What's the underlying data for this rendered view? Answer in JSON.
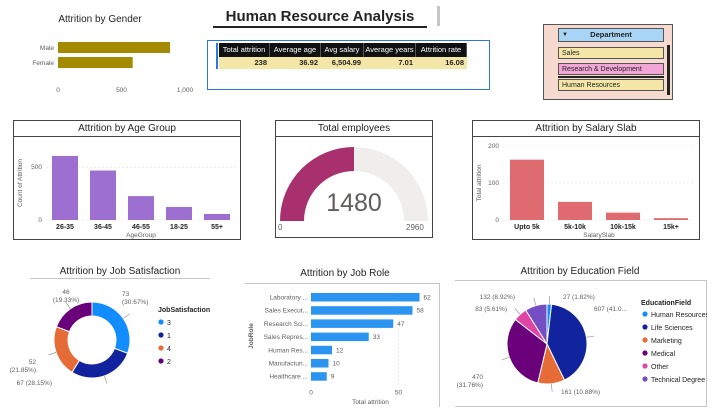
{
  "header": {
    "title": "Human Resource Analysis"
  },
  "kpi": {
    "headers": [
      "Total attrition",
      "Average age",
      "Avg salary",
      "Average years",
      "Attrition rate"
    ],
    "values": [
      "238",
      "36.92",
      "6,504.99",
      "7.01",
      "16.08"
    ]
  },
  "department": {
    "title": "Department",
    "items": [
      "Sales",
      "Research & Development",
      "Human Resources"
    ],
    "colors": [
      "#f4e6a6",
      "#f2a6d6",
      "#f4e6a6"
    ]
  },
  "gauge": {
    "title": "Total employees",
    "value_label": "1480",
    "min_label": "0",
    "max_label": "2960",
    "value": 1480,
    "max": 2960,
    "fill_color": "#a8306f",
    "track_color": "#efeeed"
  },
  "chart_data": [
    {
      "type": "bar",
      "orientation": "horizontal",
      "title": "Attrition by Gender",
      "categories": [
        "Male",
        "Female"
      ],
      "values": [
        882,
        588
      ],
      "xticks": [
        "0",
        "500",
        "1,000"
      ],
      "xlim": [
        0,
        1000
      ],
      "color": "#a38a00"
    },
    {
      "type": "bar",
      "title": "Attrition by Age Group",
      "categories": [
        "26-35",
        "36-45",
        "46-55",
        "18-25",
        "55+"
      ],
      "values": [
        606,
        468,
        226,
        123,
        57
      ],
      "xlabel": "AgeGroup",
      "ylabel": "Count of Attrition",
      "yticks": [
        "0",
        "500"
      ],
      "ylim": [
        0,
        700
      ],
      "color": "#9c6fd1"
    },
    {
      "type": "bar",
      "title": "Attrition by Salary Slab",
      "categories": [
        "Upto 5k",
        "5k-10k",
        "10k-15k",
        "15k+"
      ],
      "values": [
        163,
        49,
        20,
        5
      ],
      "xlabel": "SalarySlab",
      "ylabel": "Total attrition",
      "yticks": [
        "0",
        "100",
        "200"
      ],
      "ylim": [
        0,
        200
      ],
      "color": "#df6b71"
    },
    {
      "type": "pie",
      "variant": "donut",
      "title": "Attrition by Job Satisfaction",
      "legend_title": "JobSatisfaction",
      "series": [
        {
          "name": "3",
          "value": 73,
          "label": "73\n(30.67%)",
          "color": "#118dff"
        },
        {
          "name": "1",
          "value": 67,
          "label": "67 (28.15%)",
          "color": "#12239e"
        },
        {
          "name": "4",
          "value": 52,
          "label": "52\n(21.85%)",
          "color": "#e66c37"
        },
        {
          "name": "2",
          "value": 46,
          "label": "46\n(19.33%)",
          "color": "#6b007b"
        }
      ]
    },
    {
      "type": "bar",
      "orientation": "horizontal",
      "title": "Attrition by Job Role",
      "categories": [
        "Laboratory ...",
        "Sales Execut...",
        "Research Sci...",
        "Sales Repres...",
        "Human Res...",
        "Manufacturi...",
        "Healthcare ..."
      ],
      "values": [
        62,
        58,
        47,
        33,
        12,
        10,
        9
      ],
      "xlabel": "Total attrition",
      "ylabel": "JobRole",
      "xticks": [
        "0",
        "50"
      ],
      "xlim": [
        0,
        68
      ],
      "color": "#2b94f0"
    },
    {
      "type": "pie",
      "title": "Attrition by Education Field",
      "legend_title": "EducationField",
      "series": [
        {
          "name": "Human Resources",
          "value": 27,
          "label": "27 (1.82%)",
          "color": "#118dff"
        },
        {
          "name": "Life Sciences",
          "value": 607,
          "label": "607 (41.0...",
          "color": "#12239e"
        },
        {
          "name": "Marketing",
          "value": 161,
          "label": "161 (10.88%)",
          "color": "#e66c37"
        },
        {
          "name": "Medical",
          "value": 470,
          "label": "470\n(31.76%)",
          "color": "#6b007b"
        },
        {
          "name": "Other",
          "value": 83,
          "label": "83 (5.61%)",
          "color": "#e044a7"
        },
        {
          "name": "Technical Degree",
          "value": 132,
          "label": "132 (8.92%)",
          "color": "#744ec2"
        }
      ]
    }
  ]
}
